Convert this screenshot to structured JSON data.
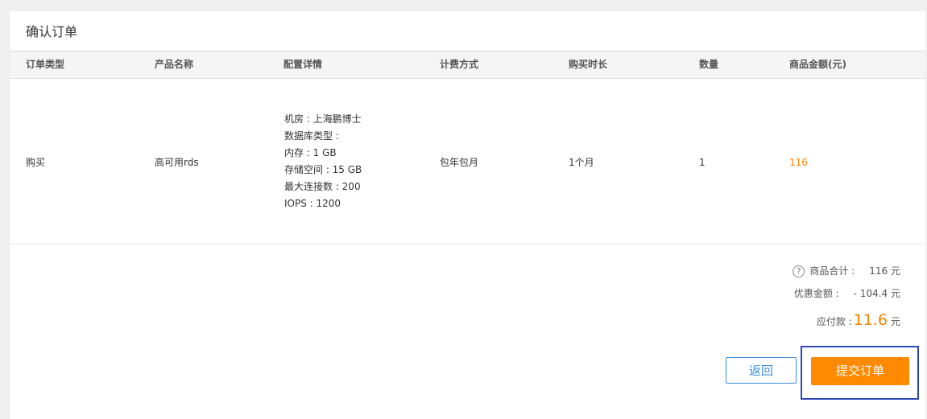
{
  "page": {
    "title": "确认订单"
  },
  "table": {
    "headers": [
      "订单类型",
      "产品名称",
      "配置详情",
      "计费方式",
      "购买时长",
      "数量",
      "商品金额(元)"
    ],
    "row": {
      "order_type": "购买",
      "product_name": "高可用rds",
      "config": [
        "机房 : 上海鹏博士",
        "数据库类型 :",
        "内存 : 1 GB",
        "存储空间 : 15 GB",
        "最大连接数 : 200",
        "IOPS : 1200"
      ],
      "billing": "包年包月",
      "duration": "1个月",
      "quantity": "1",
      "amount": "116"
    }
  },
  "summary": {
    "help_icon_glyph": "?",
    "subtotal_label": "商品合计 :",
    "subtotal_value": "116 元",
    "discount_label": "优惠金额 :",
    "discount_value": "- 104.4 元",
    "payable_label": "应付款 :",
    "payable_value": "11.6",
    "payable_unit": "元"
  },
  "buttons": {
    "back_label": "返回",
    "submit_label": "提交订单"
  },
  "colors": {
    "accent_orange": "#ff8a00",
    "link_blue": "#3c8dde",
    "highlight_border": "#2f46b8"
  }
}
